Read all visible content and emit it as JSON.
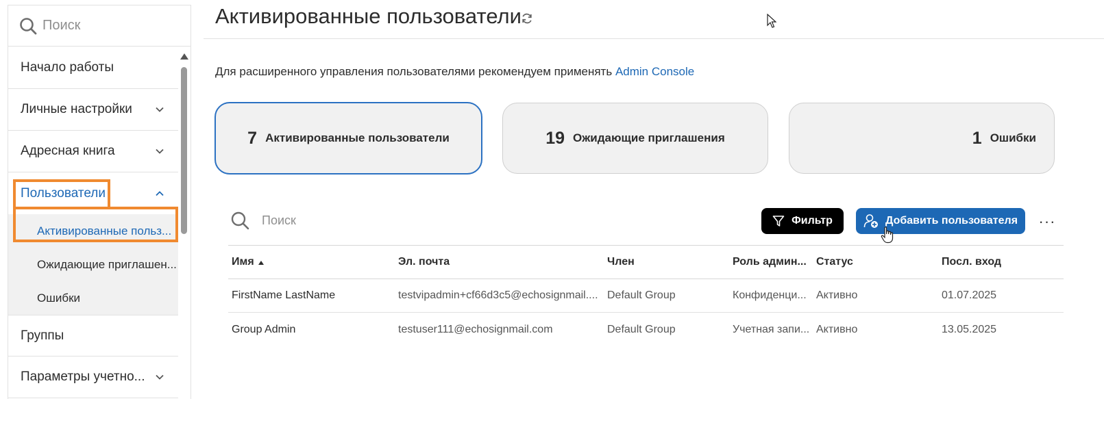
{
  "sidebar": {
    "search_placeholder": "Поиск",
    "items": [
      {
        "label": "Начало работы"
      },
      {
        "label": "Личные настройки"
      },
      {
        "label": "Адресная книга"
      },
      {
        "label": "Пользователи"
      },
      {
        "label": "Группы"
      },
      {
        "label": "Параметры учетно..."
      }
    ],
    "subitems": [
      {
        "label": "Активированные польз..."
      },
      {
        "label": "Ожидающие приглашен..."
      },
      {
        "label": "Ошибки"
      }
    ]
  },
  "header": {
    "title": "Активированные пользователи"
  },
  "info": {
    "text": "Для расширенного управления пользователями рекомендуем применять ",
    "link": "Admin Console"
  },
  "cards": [
    {
      "count": "7",
      "label": "Активированные пользователи"
    },
    {
      "count": "19",
      "label": "Ожидающие приглашения"
    },
    {
      "count": "1",
      "label": "Ошибки"
    }
  ],
  "toolbar": {
    "search_placeholder": "Поиск",
    "filter_label": "Фильтр",
    "add_label": "Добавить пользователя",
    "more_label": "···"
  },
  "table": {
    "columns": [
      "Имя",
      "Эл. почта",
      "Член",
      "Роль админ...",
      "Статус",
      "Посл. вход"
    ],
    "rows": [
      [
        "FirstName LastName",
        "testvipadmin+cf66d3c5@echosignmail....",
        "Default Group",
        "Конфиденци...",
        "Активно",
        "01.07.2025"
      ],
      [
        "Group Admin",
        "testuser111@echosignmail.com",
        "Default Group",
        "Учетная запи...",
        "Активно",
        "13.05.2025"
      ]
    ]
  },
  "colors": {
    "accent": "#1d68b5",
    "highlight": "#f08a30"
  }
}
